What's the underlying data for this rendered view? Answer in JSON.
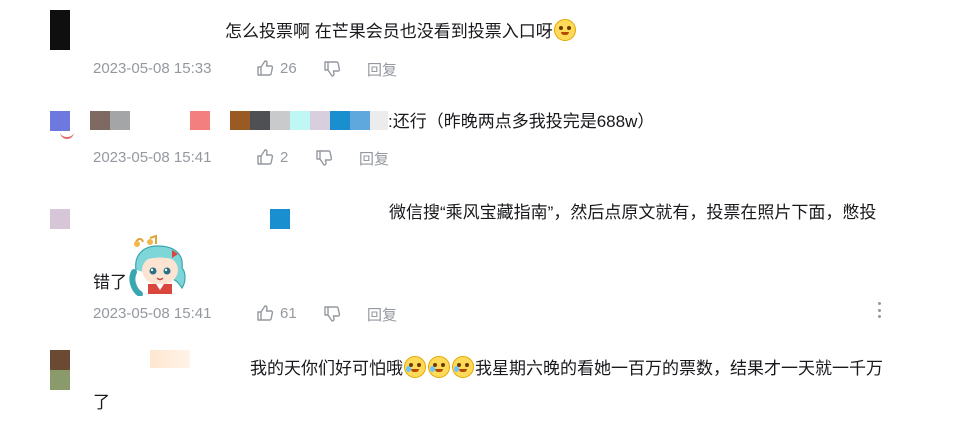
{
  "comments": [
    {
      "text": "怎么投票啊 在芒果会员也没看到投票入口呀",
      "timestamp": "2023-05-08 15:33",
      "likes": "26",
      "reply_label": "回复",
      "emoji_icon": "dizzy-face-emoji"
    },
    {
      "text": ":还行（昨晚两点多我投完是688w）",
      "timestamp": "2023-05-08 15:41",
      "likes": "2",
      "reply_label": "回复"
    },
    {
      "text_line1": "微信搜“乘风宝藏指南”，然后点原文就有，投票在照片下面，憋投",
      "text_line2": "错了",
      "timestamp": "2023-05-08 15:41",
      "likes": "61",
      "reply_label": "回复",
      "sticker_icon": "anime-girl-sticker"
    },
    {
      "text_part1": "我的天你们好可怕哦",
      "text_part2": "我星期六晚的看她一百万的票数，结果才一天就一千万",
      "text_line2": "了",
      "emoji_icon": "crying-laughing-emoji"
    }
  ],
  "colors": {
    "text": "#18191c",
    "meta": "#9499a0"
  }
}
